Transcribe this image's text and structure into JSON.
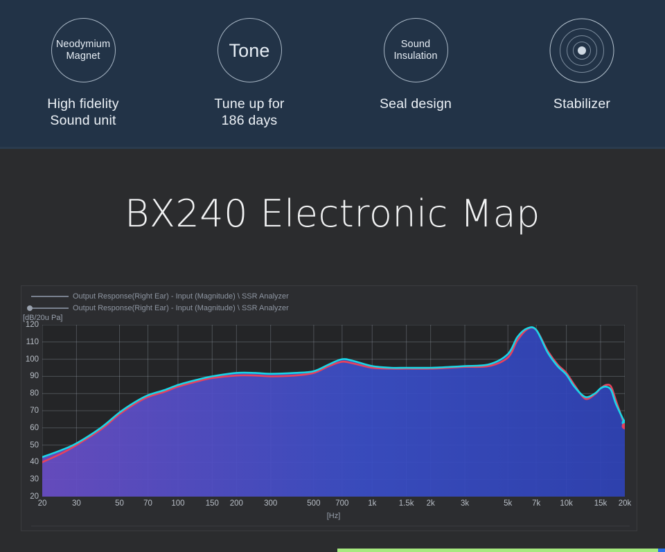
{
  "header": {
    "features": [
      {
        "icon": "neodymium-magnet-icon",
        "circle_text": "Neodymium\nMagnet",
        "label": "High fidelity\nSound unit",
        "style": "small"
      },
      {
        "icon": "tone-icon",
        "circle_text": "Tone",
        "label": "Tune up for\n186 days",
        "style": "big"
      },
      {
        "icon": "sound-insulation-icon",
        "circle_text": "Sound\nInsulation",
        "label": "Seal design",
        "style": "small"
      },
      {
        "icon": "stabilizer-rings-icon",
        "circle_text": "",
        "label": "Stabilizer",
        "style": "rings"
      }
    ],
    "background_color": "#223347"
  },
  "main": {
    "title": "BX240 Electronic Map",
    "background_color": "#2b2c2e"
  },
  "chart_data": {
    "type": "line",
    "title": "",
    "xlabel": "[Hz]",
    "ylabel": "[dB/20u Pa]",
    "xscale": "log",
    "xlim": [
      20,
      20000
    ],
    "ylim": [
      20,
      120
    ],
    "grid": true,
    "legend_position": "top-left",
    "xticks": [
      "20",
      "30",
      "50",
      "70",
      "100",
      "150",
      "200",
      "300",
      "500",
      "700",
      "1k",
      "1.5k",
      "2k",
      "3k",
      "5k",
      "7k",
      "10k",
      "15k",
      "20k"
    ],
    "xtick_values": [
      20,
      30,
      50,
      70,
      100,
      150,
      200,
      300,
      500,
      700,
      1000,
      1500,
      2000,
      3000,
      5000,
      7000,
      10000,
      15000,
      20000
    ],
    "yticks": [
      "20",
      "30",
      "40",
      "50",
      "60",
      "70",
      "80",
      "90",
      "100",
      "110",
      "120"
    ],
    "ytick_values": [
      20,
      30,
      40,
      50,
      60,
      70,
      80,
      90,
      100,
      110,
      120
    ],
    "legend": [
      "Output Response(Right Ear) - Input (Magnitude) \\ SSR Analyzer",
      "Output Response(Right Ear) - Input (Magnitude) \\ SSR Analyzer"
    ],
    "x": [
      20,
      25,
      30,
      40,
      50,
      60,
      70,
      85,
      100,
      125,
      150,
      200,
      250,
      300,
      400,
      500,
      600,
      700,
      800,
      1000,
      1250,
      1500,
      2000,
      2500,
      3000,
      4000,
      5000,
      5600,
      6300,
      7000,
      8000,
      9000,
      10000,
      11000,
      12500,
      14000,
      15000,
      16000,
      17000,
      18000,
      20000
    ],
    "series": [
      {
        "name": "Output Response(Right Ear) - Input (Magnitude) \\ SSR Analyzer",
        "color": "#19d7e8",
        "values": [
          43,
          47,
          51,
          60,
          69,
          75,
          79,
          82,
          85,
          88,
          90,
          92,
          92,
          91.5,
          92,
          93,
          97,
          100,
          99,
          96,
          95,
          95,
          95,
          95.5,
          96,
          97,
          103,
          113,
          118,
          117,
          104,
          96,
          91,
          84,
          78,
          80,
          83,
          84,
          82,
          74,
          63
        ]
      },
      {
        "name": "Output Response(Right Ear) - Input (Magnitude) \\ SSR Analyzer",
        "color": "#e8425c",
        "values": [
          40,
          45,
          50,
          59,
          68,
          74,
          78,
          81,
          84,
          87,
          89,
          90.5,
          90.5,
          90,
          90.5,
          92,
          96,
          98.5,
          97.5,
          95,
          94.5,
          94.5,
          94.5,
          95,
          95.5,
          96,
          101,
          111,
          117.5,
          117,
          105,
          97,
          92,
          85,
          77,
          79.5,
          83,
          85,
          84,
          76,
          61
        ]
      }
    ],
    "fill_gradient": [
      "#6a4ec8",
      "#3a4ec8",
      "#2f43b8"
    ],
    "marker_endpoints": [
      {
        "x": 20000,
        "y": 63,
        "color": "#19d7e8"
      },
      {
        "x": 20000,
        "y": 61,
        "color": "#e8425c"
      }
    ]
  },
  "footer": {
    "accent_color": "#a6e97f"
  }
}
